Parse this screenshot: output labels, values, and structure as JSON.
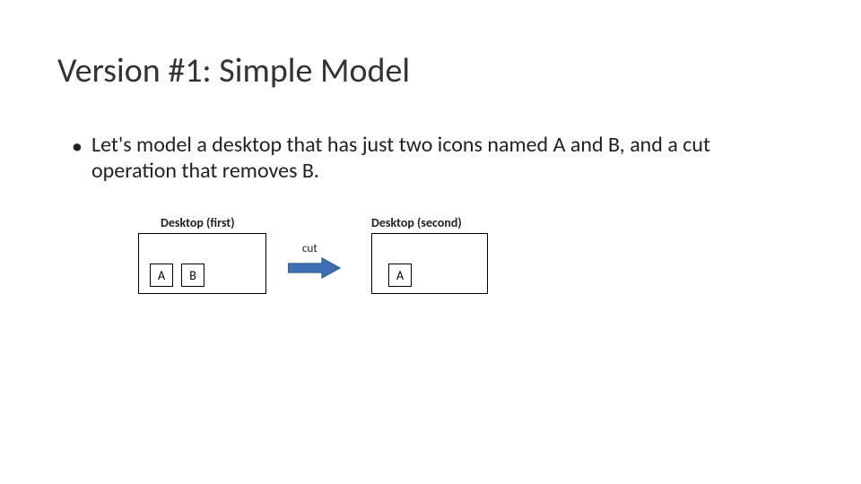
{
  "title": "Version #1: Simple Model",
  "bullet": "Let's model a desktop that has just two icons named A and B, and a cut operation that removes B.",
  "diagram": {
    "label_first": "Desktop (first)",
    "label_second": "Desktop (second)",
    "cut_label": "cut",
    "icons": {
      "a": "A",
      "b": "B"
    }
  },
  "colors": {
    "arrow_fill": "#3f6fb3",
    "arrow_stroke": "#2e5a99"
  }
}
